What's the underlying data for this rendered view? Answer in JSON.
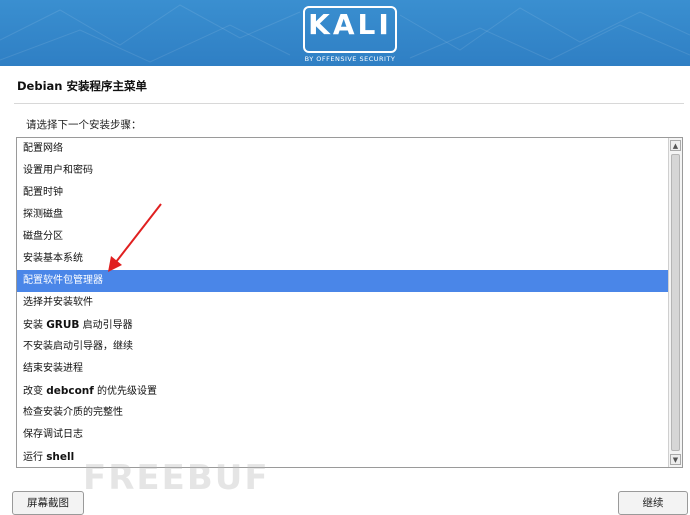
{
  "banner": {
    "logo_text": "KALI",
    "logo_subtitle": "BY OFFENSIVE SECURITY"
  },
  "window_title": "Debian 安装程序主菜单",
  "prompt": "请选择下一个安装步骤：",
  "menu": {
    "selected_index": 6,
    "items": [
      {
        "text": "配置网络"
      },
      {
        "text": "设置用户和密码"
      },
      {
        "text": "配置时钟"
      },
      {
        "text": "探测磁盘"
      },
      {
        "text": "磁盘分区"
      },
      {
        "text": "安装基本系统"
      },
      {
        "text": "配置软件包管理器"
      },
      {
        "text": "选择并安装软件"
      },
      {
        "pre": "安装 ",
        "bold": "GRUB",
        "post": " 启动引导器"
      },
      {
        "text": "不安装启动引导器，继续"
      },
      {
        "text": "结束安装进程"
      },
      {
        "pre": "改变 ",
        "bold": "debconf",
        "post": " 的优先级设置"
      },
      {
        "text": "检查安装介质的完整性"
      },
      {
        "text": "保存调试日志"
      },
      {
        "pre": "运行 ",
        "bold": "shell",
        "post": ""
      }
    ]
  },
  "buttons": {
    "screenshot": "屏幕截图",
    "continue": "继续"
  },
  "watermark": "FREEBUF",
  "colors": {
    "banner": "#2f7fc4",
    "selection": "#4a86e8",
    "annotation_arrow": "#e02020"
  }
}
